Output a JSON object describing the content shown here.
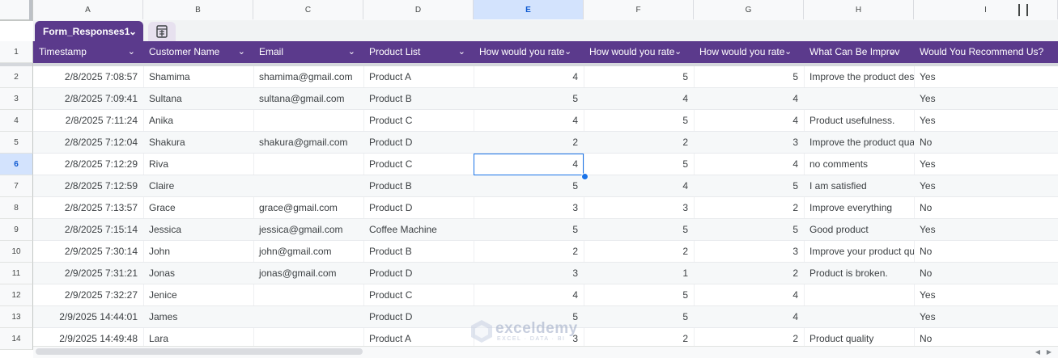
{
  "columns": [
    "A",
    "B",
    "C",
    "D",
    "E",
    "F",
    "G",
    "H",
    "I"
  ],
  "table": {
    "name": "Form_Responses1",
    "headers": [
      "Timestamp",
      "Customer Name",
      "Email",
      "Product List",
      "How would you rate",
      "How would you rate",
      "How would you rate",
      "What Can Be Improv",
      "Would You Recommend Us?"
    ]
  },
  "header_row_number": "1",
  "rows": [
    {
      "n": "2",
      "ts": "2/8/2025 7:08:57",
      "name": "Shamima",
      "email": "shamima@gmail.com",
      "product": "Product A",
      "r1": "4",
      "r2": "5",
      "r3": "5",
      "improve": "Improve the product des",
      "rec": "Yes"
    },
    {
      "n": "3",
      "ts": "2/8/2025 7:09:41",
      "name": "Sultana",
      "email": "sultana@gmail.com",
      "product": "Product B",
      "r1": "5",
      "r2": "4",
      "r3": "4",
      "improve": "",
      "rec": "Yes"
    },
    {
      "n": "4",
      "ts": "2/8/2025 7:11:24",
      "name": "Anika",
      "email": "",
      "product": "Product C",
      "r1": "4",
      "r2": "5",
      "r3": "4",
      "improve": "Product usefulness.",
      "rec": "Yes"
    },
    {
      "n": "5",
      "ts": "2/8/2025 7:12:04",
      "name": "Shakura",
      "email": "shakura@gmail.com",
      "product": "Product D",
      "r1": "2",
      "r2": "2",
      "r3": "3",
      "improve": "Improve the product qua",
      "rec": "No"
    },
    {
      "n": "6",
      "ts": "2/8/2025 7:12:29",
      "name": "Riva",
      "email": "",
      "product": "Product C",
      "r1": "4",
      "r2": "5",
      "r3": "4",
      "improve": "no comments",
      "rec": "Yes"
    },
    {
      "n": "7",
      "ts": "2/8/2025 7:12:59",
      "name": "Claire",
      "email": "",
      "product": "Product B",
      "r1": "5",
      "r2": "4",
      "r3": "5",
      "improve": "I am satisfied",
      "rec": "Yes"
    },
    {
      "n": "8",
      "ts": "2/8/2025 7:13:57",
      "name": "Grace",
      "email": "grace@gmail.com",
      "product": "Product D",
      "r1": "3",
      "r2": "3",
      "r3": "2",
      "improve": "Improve everything",
      "rec": "No"
    },
    {
      "n": "9",
      "ts": "2/8/2025 7:15:14",
      "name": "Jessica",
      "email": "jessica@gmail.com",
      "product": "Coffee Machine",
      "r1": "5",
      "r2": "5",
      "r3": "5",
      "improve": "Good product",
      "rec": "Yes"
    },
    {
      "n": "10",
      "ts": "2/9/2025 7:30:14",
      "name": "John",
      "email": "john@gmail.com",
      "product": "Product B",
      "r1": "2",
      "r2": "2",
      "r3": "3",
      "improve": "Improve your product qu",
      "rec": "No"
    },
    {
      "n": "11",
      "ts": "2/9/2025 7:31:21",
      "name": "Jonas",
      "email": "jonas@gmail.com",
      "product": "Product D",
      "r1": "3",
      "r2": "1",
      "r3": "2",
      "improve": "Product is broken.",
      "rec": "No"
    },
    {
      "n": "12",
      "ts": "2/9/2025 7:32:27",
      "name": "Jenice",
      "email": "",
      "product": "Product C",
      "r1": "4",
      "r2": "5",
      "r3": "4",
      "improve": "",
      "rec": "Yes"
    },
    {
      "n": "13",
      "ts": "2/9/2025 14:44:01",
      "name": "James",
      "email": "",
      "product": "Product D",
      "r1": "5",
      "r2": "5",
      "r3": "4",
      "improve": "",
      "rec": "Yes"
    },
    {
      "n": "14",
      "ts": "2/9/2025 14:49:48",
      "name": "Lara",
      "email": "",
      "product": "Product A",
      "r1": "3",
      "r2": "2",
      "r3": "2",
      "improve": "Product quality",
      "rec": "No"
    }
  ],
  "selected": {
    "column": "E",
    "row": "6"
  },
  "watermark": {
    "name": "exceldemy",
    "sub": "EXCEL · DATA · BI"
  },
  "colors": {
    "table_header": "#5b3a8c",
    "selection": "#1a73e8"
  }
}
